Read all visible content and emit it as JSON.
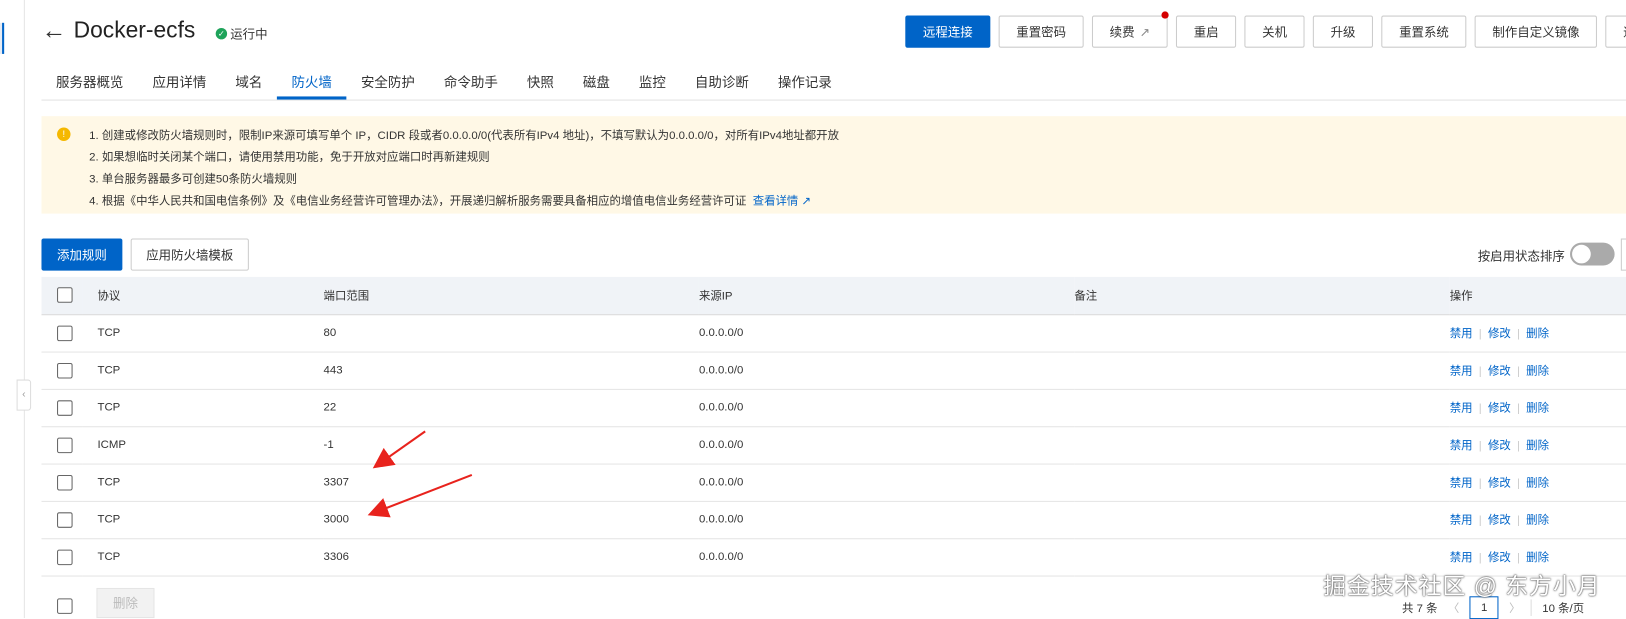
{
  "header": {
    "back_icon": "arrow-left-icon",
    "title": "Docker-ecfs",
    "status": "运行中",
    "status_color": "#1ea35a"
  },
  "actions": [
    {
      "label": "远程连接",
      "primary": true
    },
    {
      "label": "重置密码"
    },
    {
      "label": "续费",
      "external": true,
      "badge": true
    },
    {
      "label": "重启"
    },
    {
      "label": "关机"
    },
    {
      "label": "升级"
    },
    {
      "label": "重置系统"
    },
    {
      "label": "制作自定义镜像"
    },
    {
      "label": "退订"
    }
  ],
  "tabs": [
    "服务器概览",
    "应用详情",
    "域名",
    "防火墙",
    "安全防护",
    "命令助手",
    "快照",
    "磁盘",
    "监控",
    "自助诊断",
    "操作记录"
  ],
  "active_tab": "防火墙",
  "notice": {
    "lines": [
      "1. 创建或修改防火墙规则时，限制IP来源可填写单个 IP，CIDR 段或者0.0.0.0/0(代表所有IPv4 地址)，不填写默认为0.0.0.0/0，对所有IPv4地址都开放",
      "2. 如果想临时关闭某个端口，请使用禁用功能，免于开放对应端口时再新建规则",
      "3. 单台服务器最多可创建50条防火墙规则",
      "4. 根据《中华人民共和国电信条例》及《电信业务经营许可管理办法》，开展递归解析服务需要具备相应的增值电信业务经营许可证"
    ],
    "link": "查看详情"
  },
  "toolbar": {
    "add": "添加规则",
    "template": "应用防火墙模板",
    "sort_label": "按启用状态排序",
    "sort_enabled": false
  },
  "table": {
    "columns": [
      "协议",
      "端口范围",
      "来源IP",
      "备注",
      "操作"
    ],
    "rows": [
      [
        "TCP",
        "80",
        "0.0.0.0/0",
        ""
      ],
      [
        "TCP",
        "443",
        "0.0.0.0/0",
        ""
      ],
      [
        "TCP",
        "22",
        "0.0.0.0/0",
        ""
      ],
      [
        "ICMP",
        "-1",
        "0.0.0.0/0",
        ""
      ],
      [
        "TCP",
        "3307",
        "0.0.0.0/0",
        ""
      ],
      [
        "TCP",
        "3000",
        "0.0.0.0/0",
        ""
      ],
      [
        "TCP",
        "3306",
        "0.0.0.0/0",
        ""
      ]
    ],
    "ops": [
      "禁用",
      "修改",
      "删除"
    ]
  },
  "footer": {
    "delete": "删除",
    "total": "共 7 条",
    "page": "1",
    "page_size": "10 条/页"
  },
  "watermark": "掘金技术社区 @ 东方小月",
  "accent": "#0064c8",
  "annotation_color": "#e8231d"
}
